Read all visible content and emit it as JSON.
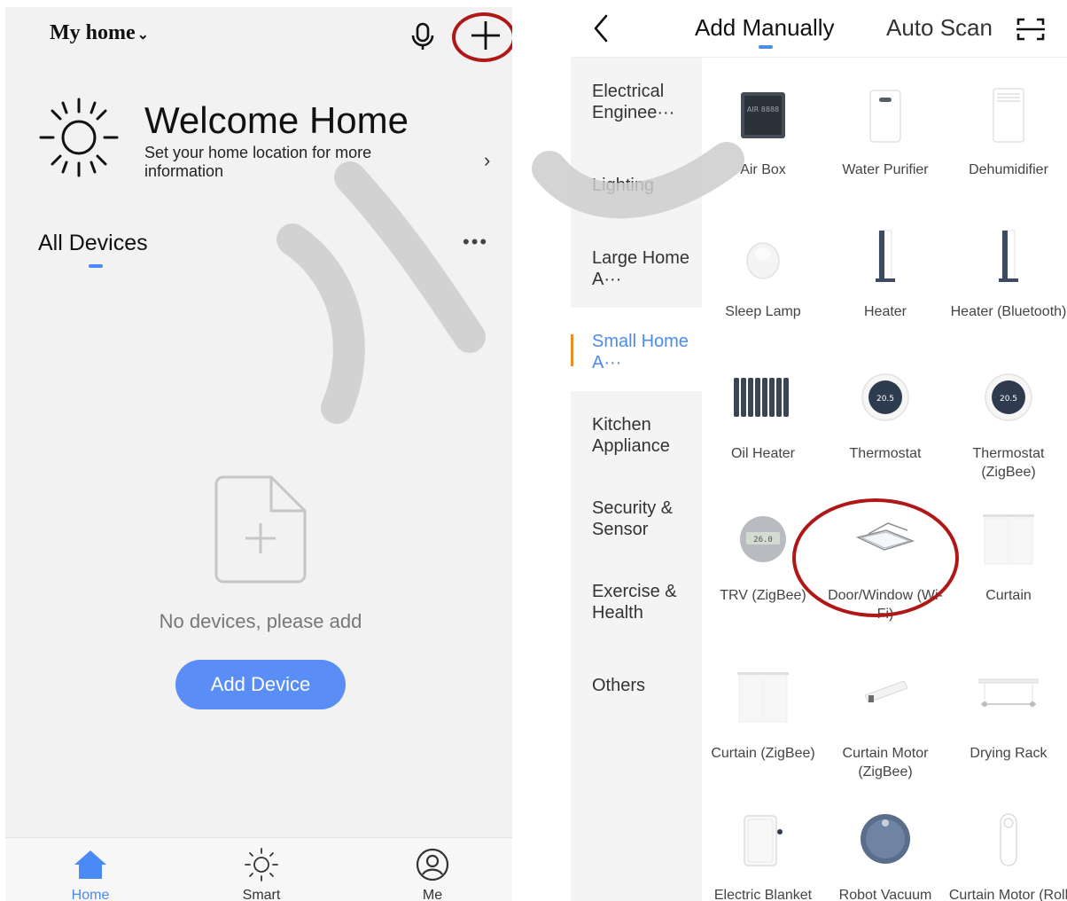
{
  "left_screen": {
    "home_title": "My home",
    "welcome": {
      "title": "Welcome Home",
      "subtitle": "Set your home location for more information",
      "arrow": "›"
    },
    "devices_title": "All Devices",
    "more_glyph": "•••",
    "empty_text": "No devices, please add",
    "add_button": "Add Device",
    "tabs": [
      {
        "label": "Home",
        "icon": "house-icon",
        "active": true
      },
      {
        "label": "Smart",
        "icon": "sun-icon",
        "active": false
      },
      {
        "label": "Me",
        "icon": "user-circle-icon",
        "active": false
      }
    ],
    "accent_color": "#4a8af4",
    "annotation_color": "#b01818"
  },
  "right_screen": {
    "tabs": {
      "manual": "Add Manually",
      "auto": "Auto Scan"
    },
    "categories": [
      {
        "label": "Electrical Enginee···",
        "active": false
      },
      {
        "label": "Lighting",
        "active": false
      },
      {
        "label": "Large Home A···",
        "active": false
      },
      {
        "label": "Small Home A···",
        "active": true
      },
      {
        "label": "Kitchen Appliance",
        "active": false
      },
      {
        "label": "Security & Sensor",
        "active": false
      },
      {
        "label": "Exercise & Health",
        "active": false
      },
      {
        "label": "Others",
        "active": false
      }
    ],
    "devices": [
      {
        "name": "Air Box",
        "icon": "air-box-icon",
        "screen_text": "AIR 8888"
      },
      {
        "name": "Water Purifier",
        "icon": "water-purifier-icon"
      },
      {
        "name": "Dehumidifier",
        "icon": "dehumidifier-icon"
      },
      {
        "name": "Sleep Lamp",
        "icon": "sleep-lamp-icon"
      },
      {
        "name": "Heater",
        "icon": "heater-icon"
      },
      {
        "name": "Heater (Bluetooth)",
        "icon": "heater-icon"
      },
      {
        "name": "Oil Heater",
        "icon": "oil-heater-icon"
      },
      {
        "name": "Thermostat",
        "icon": "thermostat-icon",
        "screen_text": "20.5"
      },
      {
        "name": "Thermostat (ZigBee)",
        "icon": "thermostat-icon",
        "screen_text": "20.5"
      },
      {
        "name": "TRV (ZigBee)",
        "icon": "trv-icon",
        "screen_text": "26.0"
      },
      {
        "name": "Door/Window (Wi-Fi)",
        "icon": "door-window-sensor-icon",
        "highlighted": true
      },
      {
        "name": "Curtain",
        "icon": "curtain-icon"
      },
      {
        "name": "Curtain (ZigBee)",
        "icon": "curtain-icon"
      },
      {
        "name": "Curtain Motor (ZigBee)",
        "icon": "curtain-motor-icon"
      },
      {
        "name": "Drying Rack",
        "icon": "drying-rack-icon"
      },
      {
        "name": "Electric Blanket",
        "icon": "electric-blanket-icon"
      },
      {
        "name": "Robot Vacuum (IPC)",
        "icon": "robot-vacuum-icon"
      },
      {
        "name": "Curtain Motor (Roll Chain)",
        "icon": "curtain-motor-roll-icon"
      }
    ]
  }
}
